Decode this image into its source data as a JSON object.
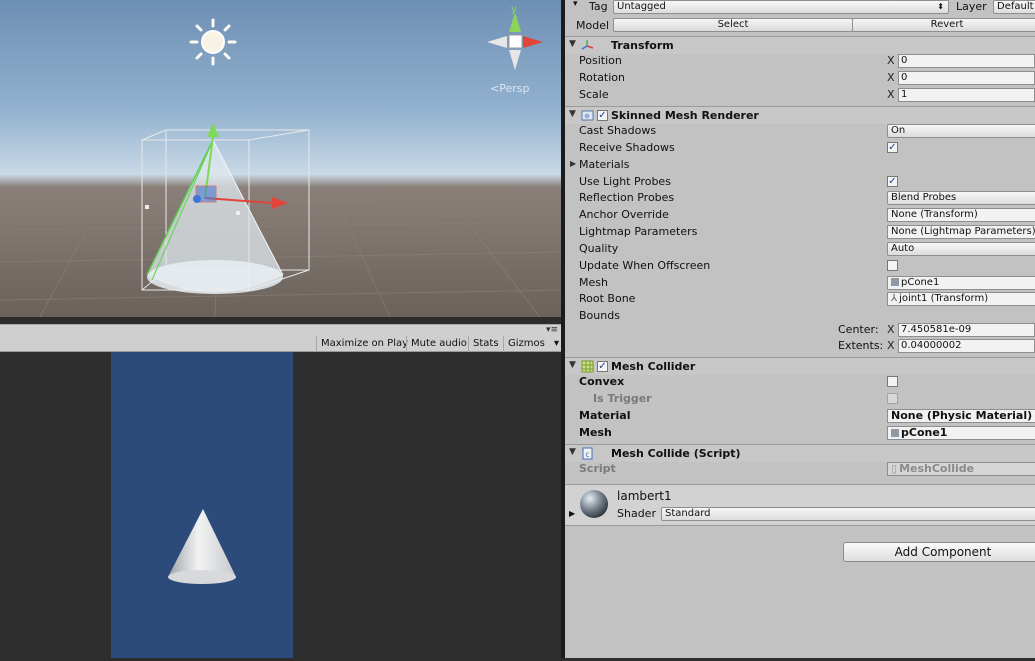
{
  "scene": {
    "persp_label": "Persp",
    "gizmo_axis_y": "y"
  },
  "game_toolbar": {
    "maximize_on_play": "Maximize on Play",
    "mute_audio": "Mute audio",
    "stats": "Stats",
    "gizmos": "Gizmos",
    "gizmos_arrow": "▾",
    "menu_icon": "▾≡"
  },
  "inspector": {
    "tag_label": "Tag",
    "tag_value": "Untagged",
    "layer_label": "Layer",
    "layer_value": "Default",
    "model_label": "Model",
    "select_button": "Select",
    "revert_button": "Revert",
    "transform": {
      "title": "Transform",
      "position_label": "Position",
      "position_x_axis": "X",
      "position_x": "0",
      "rotation_label": "Rotation",
      "rotation_x_axis": "X",
      "rotation_x": "0",
      "scale_label": "Scale",
      "scale_x_axis": "X",
      "scale_x": "1"
    },
    "skinned_mesh_renderer": {
      "title": "Skinned Mesh Renderer",
      "cast_shadows_label": "Cast Shadows",
      "cast_shadows_value": "On",
      "receive_shadows_label": "Receive Shadows",
      "receive_shadows_checked": true,
      "materials_label": "Materials",
      "use_light_probes_label": "Use Light Probes",
      "use_light_probes_checked": true,
      "reflection_probes_label": "Reflection Probes",
      "reflection_probes_value": "Blend Probes",
      "anchor_override_label": "Anchor Override",
      "anchor_override_value": "None (Transform)",
      "lightmap_parameters_label": "Lightmap Parameters",
      "lightmap_parameters_value": "None (Lightmap Parameters)",
      "quality_label": "Quality",
      "quality_value": "Auto",
      "update_offscreen_label": "Update When Offscreen",
      "update_offscreen_checked": false,
      "mesh_label": "Mesh",
      "mesh_value": "pCone1",
      "root_bone_label": "Root Bone",
      "root_bone_value": "joint1 (Transform)",
      "bounds_label": "Bounds",
      "center_label": "Center:",
      "center_axis": "X",
      "center_x": "7.450581e-09",
      "extents_label": "Extents:",
      "extents_axis": "X",
      "extents_x": "0.04000002"
    },
    "mesh_collider": {
      "title": "Mesh Collider",
      "convex_label": "Convex",
      "convex_checked": false,
      "is_trigger_label": "Is Trigger",
      "is_trigger_checked": false,
      "material_label": "Material",
      "material_value": "None (Physic Material)",
      "mesh_label": "Mesh",
      "mesh_value": "pCone1"
    },
    "mesh_collide_script": {
      "title": "Mesh Collide (Script)",
      "script_label": "Script",
      "script_value": "MeshCollide"
    },
    "material": {
      "name": "lambert1",
      "shader_label": "Shader",
      "shader_value": "Standard"
    },
    "add_component_button": "Add Component"
  },
  "colors": {
    "inspector_bg": "#c2c2c2",
    "game_viewport_bg": "#2c4a7a",
    "checkbox_tick": "#1d3f8a"
  }
}
